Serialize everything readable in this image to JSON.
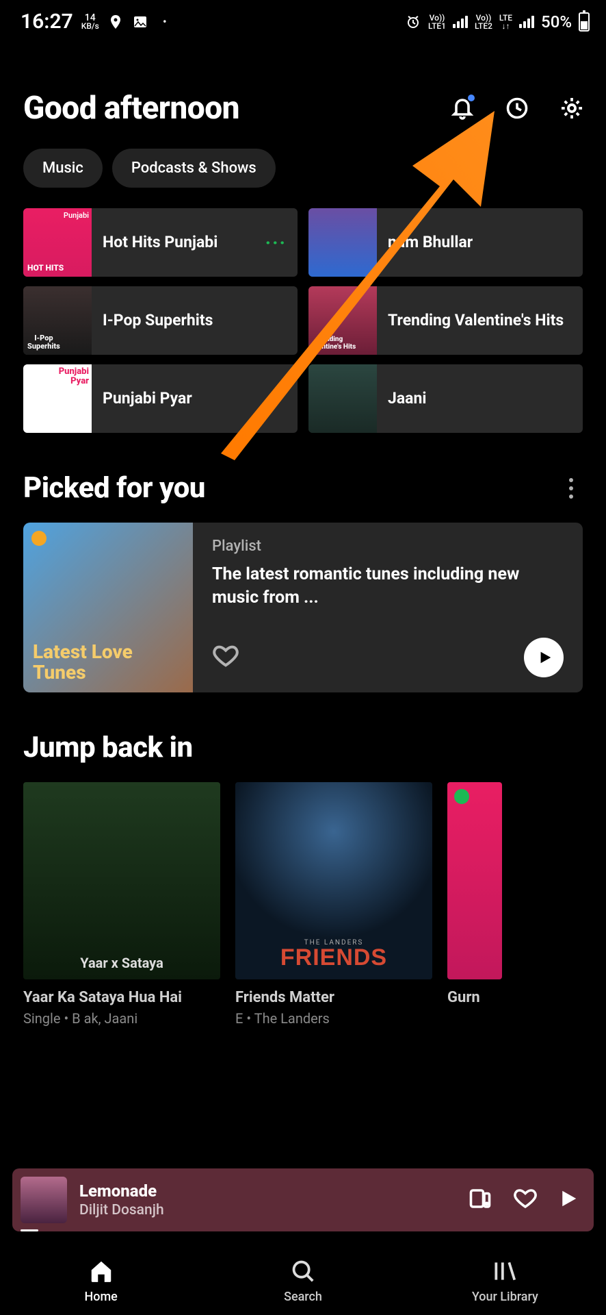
{
  "status": {
    "time": "16:27",
    "speed_value": "14",
    "speed_unit": "KB/s",
    "sim1_top": "Vo))",
    "sim1_bot": "LTE1",
    "sim2_top": "Vo))",
    "sim2_bot": "LTE2",
    "lte_ind": "LTE",
    "battery": "50%"
  },
  "header": {
    "greeting": "Good afternoon"
  },
  "chips": [
    "Music",
    "Podcasts & Shows"
  ],
  "quick": [
    {
      "label": "Hot Hits Punjabi",
      "art_text": "HOT HITS",
      "tag": "Punjabi"
    },
    {
      "label": "nam Bhullar"
    },
    {
      "label": "I-Pop Superhits",
      "art_text": "I-Pop\nSuperhits"
    },
    {
      "label": "Trending Valentine's Hits",
      "art_text": "nding\nalentine's Hits"
    },
    {
      "label": "Punjabi Pyar",
      "art_text": "Punjabi\nPyar"
    },
    {
      "label": "Jaani"
    }
  ],
  "picked": {
    "section_title": "Picked for you",
    "type": "Playlist",
    "desc": "The latest romantic tunes including new music from ...",
    "art_title": "Latest Love Tunes"
  },
  "jump": {
    "section_title": "Jump back in",
    "items": [
      {
        "title": "Yaar Ka Sataya Hua Hai",
        "sub": "Single • B        ak, Jaani",
        "art_text": "Yaar x Sataya"
      },
      {
        "title": "Friends Matter",
        "sub": "E   • The Landers",
        "art_brand": "FRIENDS",
        "art_small": "THE LANDERS"
      },
      {
        "title": "Gurn",
        "sub": ""
      }
    ]
  },
  "now_playing": {
    "title": "Lemonade",
    "artist": "Diljit Dosanjh"
  },
  "nav": {
    "home": "Home",
    "search": "Search",
    "library": "Your Library"
  }
}
